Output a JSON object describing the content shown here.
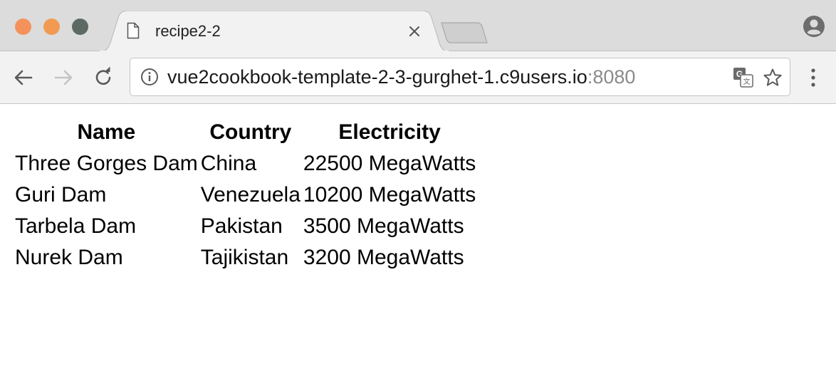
{
  "window": {
    "traffic_lights": {
      "close_color": "#f5925c",
      "minimize_color": "#f29a52",
      "maximize_color": "#5d6a63"
    }
  },
  "tabs": [
    {
      "title": "recipe2-2",
      "icon": "document-icon",
      "active": true
    }
  ],
  "toolbar": {
    "back_icon": "back-arrow-icon",
    "forward_icon": "forward-arrow-icon",
    "reload_icon": "reload-icon",
    "menu_icon": "more-vert-icon"
  },
  "address_bar": {
    "host": "vue2cookbook-template-2-3-gurghet-1.c9users.io",
    "port": ":8080",
    "info_icon": "info-icon",
    "translate_icon": "translate-icon",
    "bookmark_icon": "star-icon"
  },
  "profile_icon": "profile-icon",
  "table": {
    "headers": [
      "Name",
      "Country",
      "Electricity"
    ],
    "rows": [
      [
        "Three Gorges Dam",
        "China",
        "22500 MegaWatts"
      ],
      [
        "Guri Dam",
        "Venezuela",
        "10200 MegaWatts"
      ],
      [
        "Tarbela Dam",
        "Pakistan",
        "3500 MegaWatts"
      ],
      [
        "Nurek Dam",
        "Tajikistan",
        "3200 MegaWatts"
      ]
    ]
  }
}
